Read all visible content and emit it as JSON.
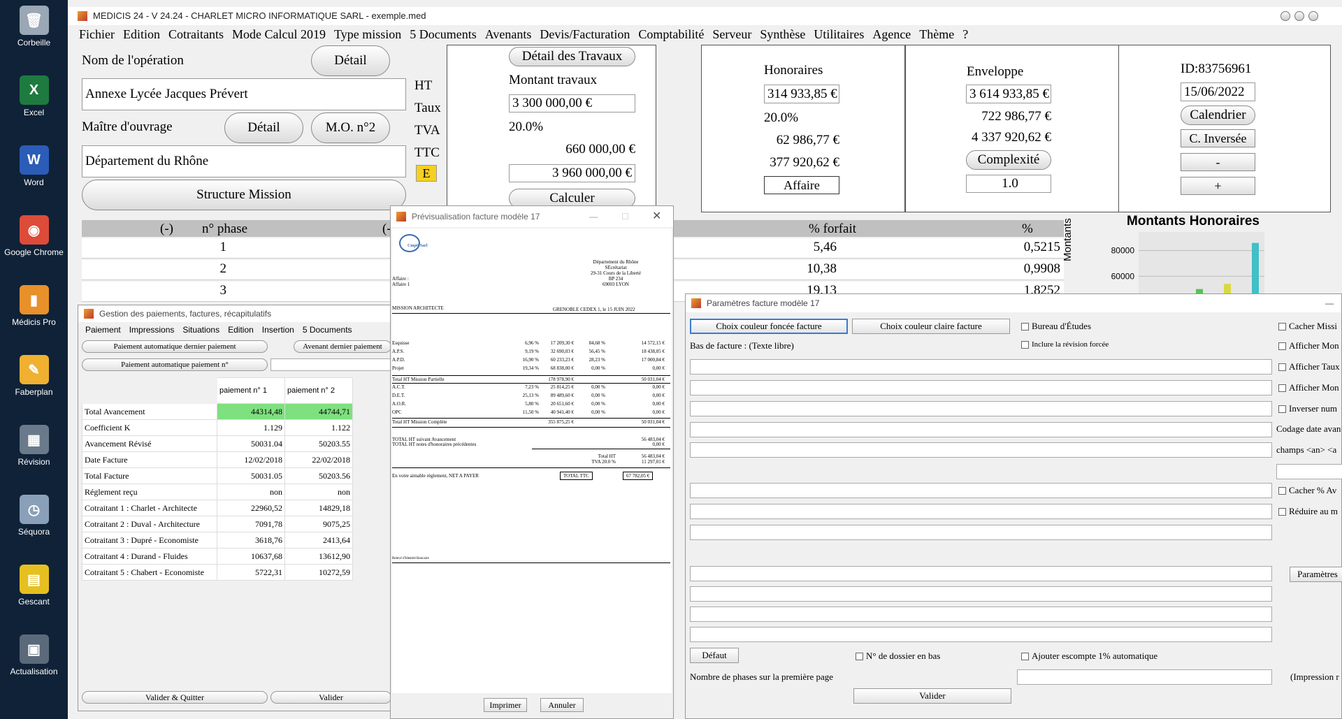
{
  "desktop": {
    "icons": [
      {
        "label": "Corbeille",
        "icon": "trash-icon",
        "color": "#9aa7b5"
      },
      {
        "label": "Excel",
        "icon": "excel-icon",
        "color": "#1f7a3f"
      },
      {
        "label": "Word",
        "icon": "word-icon",
        "color": "#2b5cb8"
      },
      {
        "label": "Google Chrome",
        "icon": "chrome-icon",
        "color": "#dd4b39"
      },
      {
        "label": "Médicis Pro",
        "icon": "medicis-icon",
        "color": "#e8902a"
      },
      {
        "label": "Faberplan",
        "icon": "faberplan-icon",
        "color": "#f0b030"
      },
      {
        "label": "Révision",
        "icon": "calculator-icon",
        "color": "#6a7a8a"
      },
      {
        "label": "Séquora",
        "icon": "clock-icon",
        "color": "#8aa0b8"
      },
      {
        "label": "Gescant",
        "icon": "ruler-icon",
        "color": "#e6c020"
      },
      {
        "label": "Actualisation",
        "icon": "payment-terminal-icon",
        "color": "#5a6a7a"
      }
    ]
  },
  "window": {
    "title": "MEDICIS 24  - V 24.24 - CHARLET MICRO INFORMATIQUE SARL - exemple.med"
  },
  "menu": [
    "Fichier",
    "Edition",
    "Cotraitants",
    "Mode Calcul 2019",
    "Type mission",
    "5 Documents",
    "Avenants",
    "Devis/Facturation",
    "Comptabilité",
    "Serveur",
    "Synthèse",
    "Utilitaires",
    "Agence",
    "Thème",
    "?"
  ],
  "operation": {
    "label": "Nom de l'opération",
    "detail_button": "Détail",
    "name": "Annexe Lycée Jacques Prévert",
    "owner_label": "Maître d'ouvrage",
    "owner_detail_button": "Détail",
    "owner2_button": "M.O. n°2",
    "owner": "Département du Rhône",
    "structure_button": "Structure Mission"
  },
  "travaux": {
    "row_labels": [
      "HT",
      "Taux",
      "TVA",
      "TTC"
    ],
    "e_badge": "E",
    "detail_button": "Détail des Travaux",
    "montant_label": "Montant travaux",
    "montant_ht": "3 300 000,00 €",
    "taux": "20.0%",
    "tva": "660 000,00 €",
    "ttc": "3 960 000,00 €",
    "calculer_button": "Calculer"
  },
  "honoraires": {
    "label": "Honoraires",
    "ht": "314 933,85 €",
    "taux": "20.0%",
    "tva": "62 986,77 €",
    "ttc": "377 920,62 €",
    "affaire_button": "Affaire"
  },
  "enveloppe": {
    "label": "Enveloppe",
    "ht": "3 614 933,85 €",
    "tva": "722 986,77 €",
    "ttc": "4 337 920,62 €",
    "complexite_button": "Complexité",
    "complexite_value": "1.0"
  },
  "info": {
    "id": "ID:83756961",
    "date": "15/06/2022",
    "calendrier_button": "Calendrier",
    "inversee_button": "C. Inversée",
    "minus_button": "-",
    "plus_button": "+"
  },
  "phases": {
    "headers": [
      "(-)",
      "n° phase",
      "(-",
      "% forfait",
      "% travaux"
    ],
    "rows": [
      {
        "n": "1",
        "forfait": "5,46",
        "travaux": "0,5215"
      },
      {
        "n": "2",
        "forfait": "10,38",
        "travaux": "0,9908"
      },
      {
        "n": "3",
        "forfait": "19,13",
        "travaux": "1,8252"
      }
    ]
  },
  "chart": {
    "title": "Montants Honoraires",
    "ylabel": "Montants",
    "ticks": [
      "80000",
      "60000"
    ]
  },
  "chart_data": {
    "type": "bar",
    "title": "Montants Honoraires",
    "ylabel": "Montants",
    "yticks": [
      60000,
      80000
    ],
    "values": [
      50000,
      54000,
      86000
    ],
    "colors": [
      "#5ac05a",
      "#d8d840",
      "#40c0c8"
    ]
  },
  "payments": {
    "title": "Gestion des paiements, factures, récapitulatifs",
    "menu": [
      "Paiement",
      "Impressions",
      "Situations",
      "Edition",
      "Insertion",
      "5 Documents"
    ],
    "auto_last_button": "Paiement automatique dernier paiement",
    "avenant_button": "Avenant dernier paiement",
    "auto_n_button": "Paiement automatique paiement n°",
    "columns": [
      "paiement n° 1",
      "paiement n° 2"
    ],
    "rows": [
      {
        "label": "Total Avancement",
        "v1": "44314,48",
        "v2": "44744,71",
        "highlight": true
      },
      {
        "label": "Coefficient K",
        "v1": "1.129",
        "v2": "1.122"
      },
      {
        "label": "Avancement Révisé",
        "v1": "50031.04",
        "v2": "50203.55"
      },
      {
        "label": "Date Facture",
        "v1": "12/02/2018",
        "v2": "22/02/2018"
      },
      {
        "label": "Total Facture",
        "v1": "50031.05",
        "v2": "50203.56"
      },
      {
        "label": "Réglement reçu",
        "v1": "non",
        "v2": "non"
      },
      {
        "label": "Cotraitant 1 : Charlet - Architecte",
        "v1": "22960,52",
        "v2": "14829,18"
      },
      {
        "label": "Cotraitant 2 : Duval - Architecture",
        "v1": "7091,78",
        "v2": "9075,25"
      },
      {
        "label": "Cotraitant 3 : Dupré - Economiste",
        "v1": "3618,76",
        "v2": "2413,64"
      },
      {
        "label": "Cotraitant 4 : Durand - Fluides",
        "v1": "10637,68",
        "v2": "13612,90"
      },
      {
        "label": "Cotraitant 5 : Chabert - Economiste",
        "v1": "5722,31",
        "v2": "10272,59"
      }
    ],
    "valider_quitter_button": "Valider & Quitter",
    "valider_button": "Valider"
  },
  "preview": {
    "title": "Prévisualisation facture modèle 17",
    "logo_text": "Cmpti Sarl",
    "address": [
      "Département du Rhône",
      "SEcrétariat",
      "29-31 Cours de la Liberté",
      "BP 234",
      "69003 LYON"
    ],
    "affaire_lines": [
      "Affaire :",
      "Affaire 1"
    ],
    "mission": "MISSION ARCHITECTE",
    "place_date": "GRENOBLE CEDEX 1, le 15 JUIN 2022",
    "lines": [
      {
        "name": "Esquisse",
        "pct": "6,96 %",
        "amount": "17 209,30 €",
        "pct2": "84,68 %",
        "total": "14 572,15 €"
      },
      {
        "name": "A.P.S.",
        "pct": "9,19 %",
        "amount": "32 690,03 €",
        "pct2": "56,45 %",
        "total": "18 438,05 €"
      },
      {
        "name": "A.P.D.",
        "pct": "16,90 %",
        "amount": "60 233,23 €",
        "pct2": "28,23 %",
        "total": "17 000,84 €"
      },
      {
        "name": "Projet",
        "pct": "19,34 %",
        "amount": "68 838,00 €",
        "pct2": "0,00 %",
        "total": "0,00 €"
      }
    ],
    "subtotal1_label": "Total HT Mission Partielle",
    "subtotal1_amount": "178 978,90 €",
    "subtotal1_total": "50 031,04 €",
    "lines2": [
      {
        "name": "A.C.T.",
        "pct": "7,23 %",
        "amount": "25 814,25 €",
        "pct2": "0,00 %",
        "total": "0,00 €"
      },
      {
        "name": "D.E.T.",
        "pct": "25,13 %",
        "amount": "89 489,60 €",
        "pct2": "0,00 %",
        "total": "0,00 €"
      },
      {
        "name": "A.O.R.",
        "pct": "5,80 %",
        "amount": "20 651,60 €",
        "pct2": "0,00 %",
        "total": "0,00 €"
      },
      {
        "name": "OPC",
        "pct": "11,50 %",
        "amount": "40 941,40 €",
        "pct2": "0,00 %",
        "total": "0,00 €"
      }
    ],
    "subtotal2_label": "Total HT Mission Complète",
    "subtotal2_amount": "355 875,25 €",
    "subtotal2_total": "50 031,04 €",
    "total_av_label": "TOTAL HT suivant Avancement",
    "total_av_value": "56 483,04 €",
    "total_prev_label": "TOTAL HT notes d'honoraires précédentes",
    "total_prev_value": "0,00 €",
    "total_ht_label": "Total HT",
    "total_ht_value": "56 483,04 €",
    "tva_label": "TVA 20.0 %",
    "tva_value": "11 297,01 €",
    "payment_label": "En votre aimable règlement, NET A PAYER",
    "total_ttc_label": "TOTAL TTC",
    "total_ttc_value": "67 782,05 €",
    "footer_text": "Relevé d'Identité Bancaire",
    "print_button": "Imprimer",
    "cancel_button": "Annuler"
  },
  "params": {
    "title": "Paramètres facture modèle 17",
    "dark_color_button": "Choix couleur foncée facture",
    "light_color_button": "Choix couleur claire facture",
    "bureau_etudes": "Bureau d'Études",
    "cacher_missi": "Cacher Missi",
    "bas_label": "Bas de facture : (Texte libre)",
    "inclure_revision": "Inclure la révision forcée",
    "afficher_mon1": "Afficher Mon",
    "afficher_taux": "Afficher Taux",
    "afficher_mon2": "Afficher Mon",
    "inverser_num": "Inverser num",
    "codage_label": "Codage date avan",
    "champs_label": "champs <an> <a",
    "cacher_av": "Cacher % Av",
    "reduire": "Réduire au m",
    "parametres_button": "Paramètres",
    "defaut_button": "Défaut",
    "dossier_bas": "N° de dossier en bas",
    "escompte": "Ajouter escompte 1% automatique",
    "phases_label": "Nombre de phases sur la première page",
    "impression_label": "(Impression r",
    "valider_button": "Valider"
  }
}
